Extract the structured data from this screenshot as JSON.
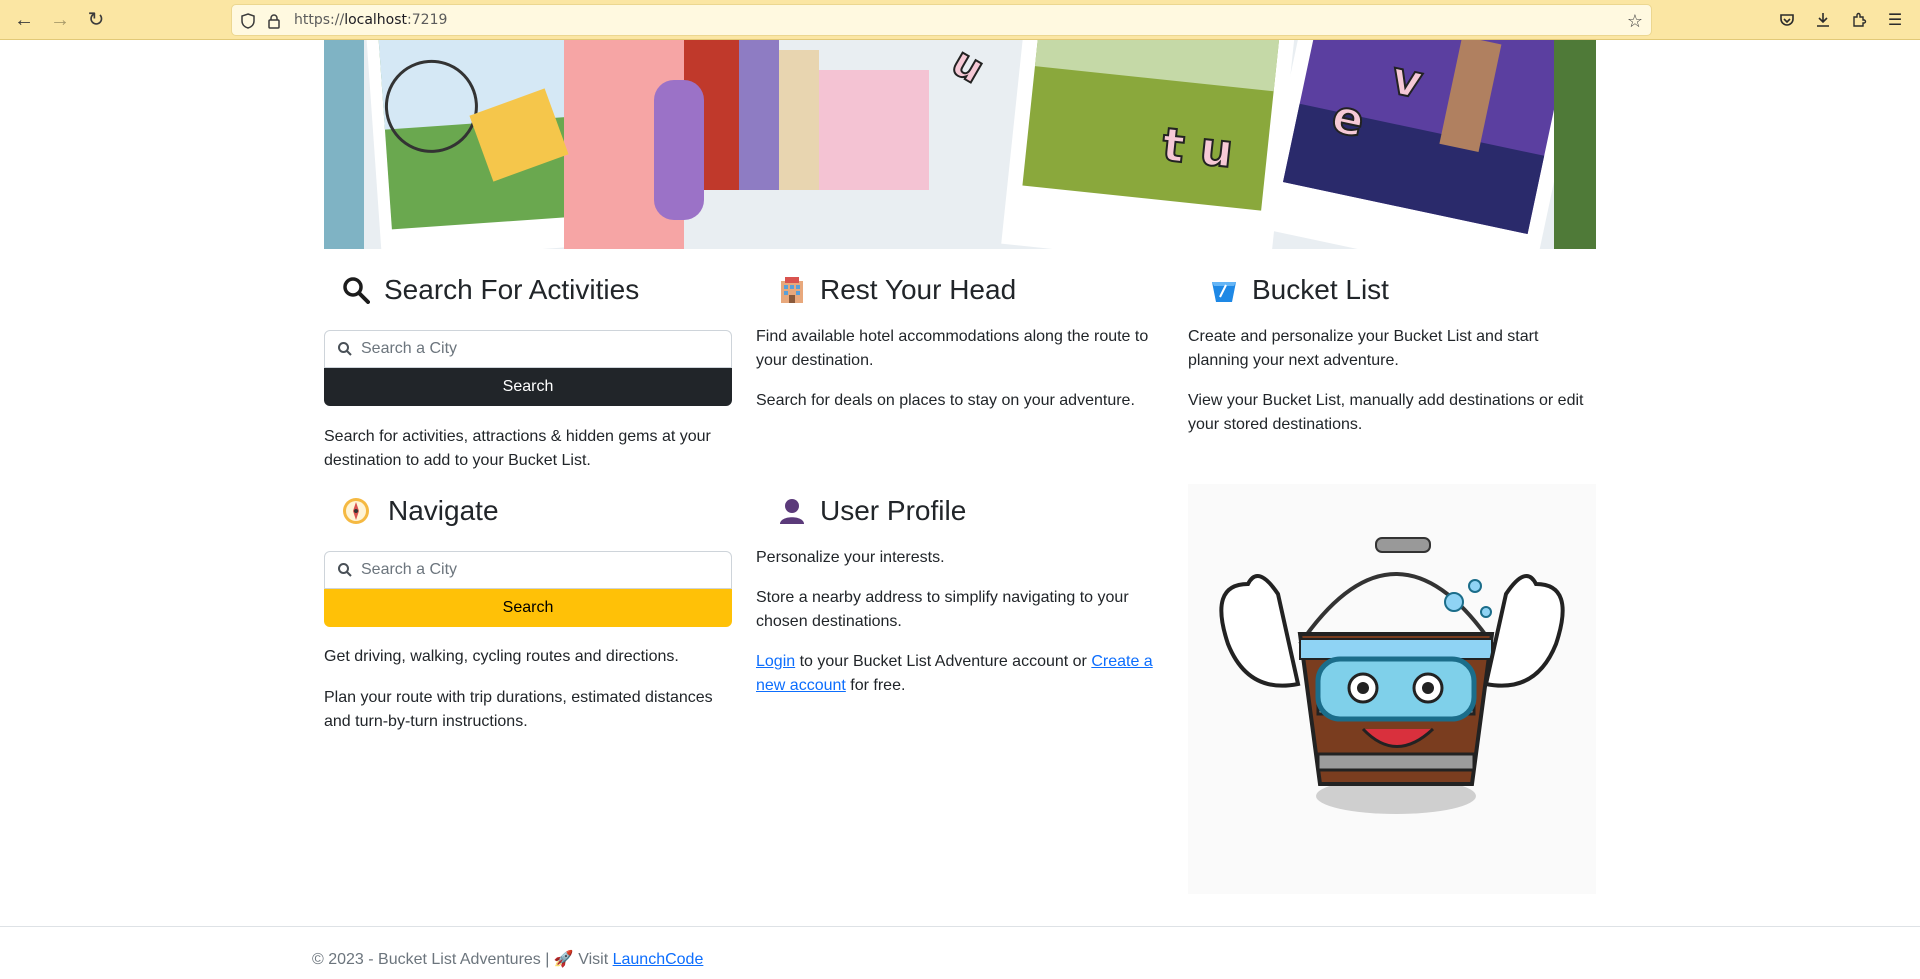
{
  "browser": {
    "url_prefix": "https://",
    "url_host": "localhost",
    "url_port": ":7219",
    "back_icon": "back-arrow-icon",
    "forward_icon": "forward-arrow-icon",
    "reload_icon": "reload-icon"
  },
  "activities": {
    "title": "Search For Activities",
    "icon": "magnifier-icon",
    "search_placeholder": "Search a City",
    "search_button": "Search",
    "description": "Search for activities, attractions & hidden gems at your destination to add to your Bucket List."
  },
  "hotels": {
    "title": "Rest Your Head",
    "icon": "hotel-icon",
    "description_1": "Find available hotel accommodations along the route to your destination.",
    "description_2": "Search for deals on places to stay on your adventure."
  },
  "bucket_list": {
    "title": "Bucket List",
    "icon": "bucket-icon",
    "description_1": "Create and personalize your Bucket List and start planning your next adventure.",
    "description_2": "View your Bucket List, manually add destinations or edit your stored destinations."
  },
  "navigate": {
    "title": "Navigate",
    "icon": "compass-icon",
    "search_placeholder": "Search a City",
    "search_button": "Search",
    "description_1": "Get driving, walking, cycling routes and directions.",
    "description_2": "Plan your route with trip durations, estimated distances and turn-by-turn instructions."
  },
  "profile": {
    "title": "User Profile",
    "icon": "user-silhouette-icon",
    "description_1": "Personalize your interests.",
    "description_2": "Store a nearby address to simplify navigating to your chosen destinations.",
    "login_link": "Login",
    "login_text": " to your Bucket List Adventure account or ",
    "create_link": "Create a new account",
    "create_text": " for free."
  },
  "footer": {
    "copyright": "© 2023 - Bucket List Adventures | ",
    "rocket": "🚀",
    "visit": " Visit ",
    "link": "LaunchCode"
  },
  "colors": {
    "dark_button": "#212529",
    "warning_button": "#ffc107",
    "link": "#0d6efd",
    "browser_bar": "#fbe6a3"
  }
}
